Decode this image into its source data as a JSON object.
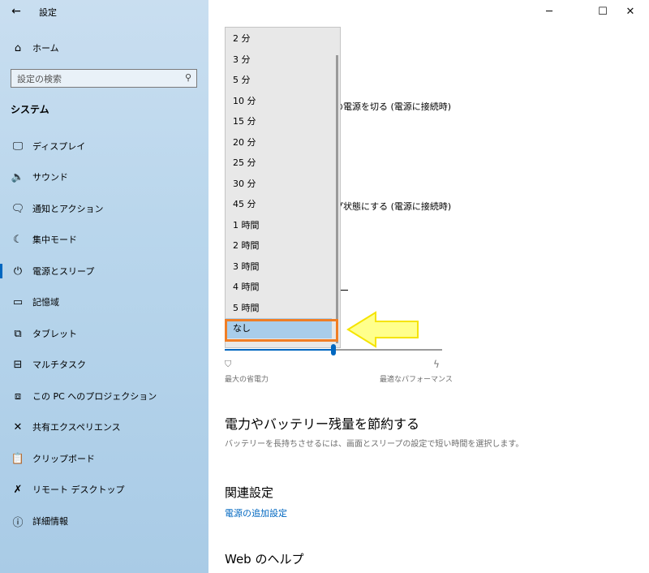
{
  "window": {
    "title": "設定",
    "back_icon": "←",
    "minimize": "─",
    "maximize": "☐",
    "close": "✕"
  },
  "sidebar": {
    "home_label": "ホーム",
    "search_placeholder": "設定の検索",
    "section_title": "システム",
    "items": [
      {
        "icon": "display-icon",
        "glyph": "🖵",
        "label": "ディスプレイ"
      },
      {
        "icon": "sound-icon",
        "glyph": "🔈",
        "label": "サウンド"
      },
      {
        "icon": "notification-icon",
        "glyph": "🗨",
        "label": "通知とアクション"
      },
      {
        "icon": "focus-assist-icon",
        "glyph": "☾",
        "label": "集中モード"
      },
      {
        "icon": "power-icon",
        "glyph": "⏻",
        "label": "電源とスリープ"
      },
      {
        "icon": "storage-icon",
        "glyph": "▭",
        "label": "記憶域"
      },
      {
        "icon": "tablet-icon",
        "glyph": "⧉",
        "label": "タブレット"
      },
      {
        "icon": "multitasking-icon",
        "glyph": "⊟",
        "label": "マルチタスク"
      },
      {
        "icon": "projecting-icon",
        "glyph": "⧈",
        "label": "この PC へのプロジェクション"
      },
      {
        "icon": "shared-experiences-icon",
        "glyph": "✕",
        "label": "共有エクスペリエンス"
      },
      {
        "icon": "clipboard-icon",
        "glyph": "📋",
        "label": "クリップボード"
      },
      {
        "icon": "remote-desktop-icon",
        "glyph": "✗",
        "label": "リモート デスクトップ"
      },
      {
        "icon": "about-icon",
        "glyph": "ⓘ",
        "label": "詳細情報"
      }
    ],
    "active_index": 4
  },
  "content": {
    "partial_text_1": "の電源を切る (電源に接続時)",
    "partial_text_2": "プ状態にする (電源に接続時)",
    "dropdown_options": [
      "2 分",
      "3 分",
      "5 分",
      "10 分",
      "15 分",
      "20 分",
      "25 分",
      "30 分",
      "45 分",
      "1 時間",
      "2 時間",
      "3 時間",
      "4 時間",
      "5 時間",
      "なし"
    ],
    "selected_option": "なし",
    "slider": {
      "left_label": "最大の省電力",
      "right_label": "最適なパフォーマンス",
      "value_fraction": 0.5
    },
    "save_heading": "電力やバッテリー残量を節約する",
    "save_desc": "バッテリーを長持ちさせるには、画面とスリープの設定で短い時間を選択します。",
    "related_heading": "関連設定",
    "related_link": "電源の追加設定",
    "web_help_heading": "Web のヘルプ"
  },
  "colors": {
    "accent": "#0067c0",
    "highlight_box": "#f07e26",
    "arrow_fill": "#ffff8c",
    "arrow_stroke": "#f5e400"
  }
}
